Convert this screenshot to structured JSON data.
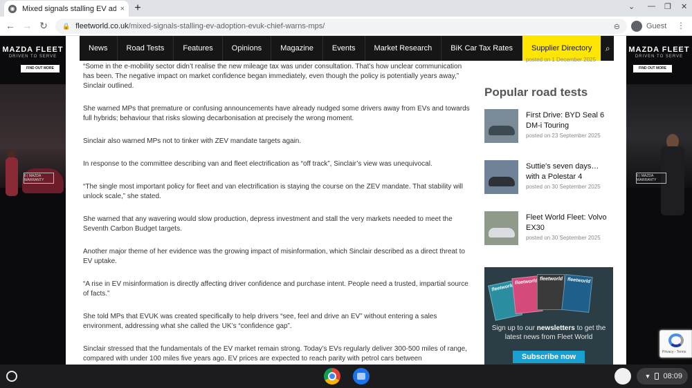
{
  "browser": {
    "tab_title": "Mixed signals stalling EV adoptio",
    "tab_close": "×",
    "new_tab": "+",
    "url_host": "fleetworld.co.uk",
    "url_path": "/mixed-signals-stalling-ev-adoption-evuk-chief-warns-mps/",
    "profile_label": "Guest"
  },
  "ads": {
    "brand": "MAZDA FLEET",
    "tagline": "DRIVEN TO SERVE",
    "button": "FIND OUT MORE",
    "warranty": "6 | MAZDA WARRANTY"
  },
  "site_nav": {
    "items": [
      "News",
      "Road Tests",
      "Features",
      "Opinions",
      "Magazine",
      "Events",
      "Market Research",
      "BiK Car Tax Rates"
    ],
    "highlight": "Supplier Directory"
  },
  "article": {
    "paragraphs": [
      "“Some in the e-mobility sector didn’t realise the new mileage tax was under consultation. That’s how unclear communication has been. The negative impact on market confidence began immediately, even though the policy is potentially years away,” Sinclair outlined.",
      "She warned MPs that premature or confusing announcements have already nudged some drivers away from EVs and towards full hybrids; behaviour that risks slowing decarbonisation at precisely the wrong moment.",
      "Sinclair also warned MPs not to tinker with ZEV mandate targets again.",
      "In response to the committee describing van and fleet electrification as “off track”, Sinclair’s view was unequivocal.",
      "“The single most important policy for fleet and van electrification is staying the course on the ZEV mandate. That stability will unlock scale,” she stated.",
      "She warned that any wavering would slow production, depress investment and stall the very markets needed to meet the Seventh Carbon Budget targets.",
      "Another major theme of her evidence was the growing impact of misinformation, which Sinclair described as a direct threat to EV uptake.",
      "“A rise in EV misinformation is directly affecting driver confidence and purchase intent. People need a trusted, impartial source of facts.”",
      "She told MPs that EVUK was created specifically to help drivers “see, feel and drive an EV” without entering a sales environment, addressing what she called the UK’s “confidence gap”.",
      "Sinclair stressed that the fundamentals of the EV market remain strong. Today’s EVs regularly deliver 300-500 miles of range, compared with under 100 miles five years ago. EV prices are expected to reach parity with petrol cars between"
    ]
  },
  "sidebar": {
    "posted_top": "posted on 1 December 2025",
    "heading": "Popular road tests",
    "road_tests": [
      {
        "title": "First Drive: BYD Seal 6 DM-i Touring",
        "date": "posted on 23 September 2025",
        "thumb_color": "#7a8a96",
        "car_color": "#3e4a52"
      },
      {
        "title": "Suttie's seven days… with a Polestar 4",
        "date": "posted on 30 September 2025",
        "thumb_color": "#6f8298",
        "car_color": "#2d3238"
      },
      {
        "title": "Fleet World Fleet: Volvo EX30",
        "date": "posted on 30 September 2025",
        "thumb_color": "#8f9a8a",
        "car_color": "#d9dde0"
      }
    ],
    "newsletter": {
      "mags": [
        "fleetworld",
        "fleetworld",
        "fleetworld",
        "fleetworld"
      ],
      "text_pre": "Sign up to our ",
      "text_bold": "newsletters",
      "text_post": " to get the latest news from Fleet World",
      "button": "Subscribe now"
    }
  },
  "recaptcha": {
    "links": "Privacy - Terms"
  },
  "shelf": {
    "time": "08:09"
  }
}
